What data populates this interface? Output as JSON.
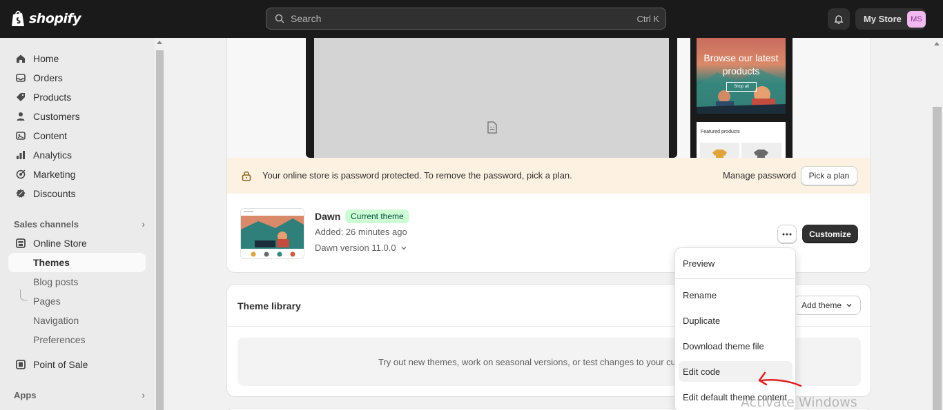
{
  "topbar": {
    "logo_text": "shopify",
    "search_placeholder": "Search",
    "search_shortcut": "Ctrl K",
    "store_name": "My Store",
    "avatar_initials": "MS"
  },
  "sidebar": {
    "main_items": [
      {
        "label": "Home",
        "icon": "home-icon"
      },
      {
        "label": "Orders",
        "icon": "orders-icon"
      },
      {
        "label": "Products",
        "icon": "tag-icon"
      },
      {
        "label": "Customers",
        "icon": "person-icon"
      },
      {
        "label": "Content",
        "icon": "content-icon"
      },
      {
        "label": "Analytics",
        "icon": "bar-chart-icon"
      },
      {
        "label": "Marketing",
        "icon": "target-icon"
      },
      {
        "label": "Discounts",
        "icon": "discount-icon"
      }
    ],
    "sales_channels_heading": "Sales channels",
    "online_store": "Online Store",
    "sub_items": [
      "Themes",
      "Blog posts",
      "Pages",
      "Navigation",
      "Preferences"
    ],
    "point_of_sale": "Point of Sale",
    "apps_heading": "Apps"
  },
  "preview": {
    "hero_title": "Browse our latest products",
    "hero_button": "Shop all",
    "featured_title": "Featured products"
  },
  "banner": {
    "text": "Your online store is password protected. To remove the password, pick a plan.",
    "manage_link": "Manage password",
    "pick_plan": "Pick a plan"
  },
  "current_theme": {
    "name": "Dawn",
    "badge": "Current theme",
    "added": "Added: 26 minutes ago",
    "version": "Dawn version 11.0.0",
    "customize_label": "Customize"
  },
  "library": {
    "title": "Theme library",
    "add_theme": "Add theme",
    "empty_text": "Try out new themes, work on seasonal versions, or test changes to your cur"
  },
  "dropdown": {
    "items": [
      "Preview",
      "Rename",
      "Duplicate",
      "Download theme file",
      "Edit code",
      "Edit default theme content"
    ]
  },
  "watermark": "Activate Windows",
  "colors": {
    "topbar": "#1a1a1a",
    "sidebar": "#ebebeb",
    "banner": "#fdf1e2",
    "badge_bg": "#cdfed4",
    "primary_button": "#303030",
    "annotation": "#e02020"
  }
}
